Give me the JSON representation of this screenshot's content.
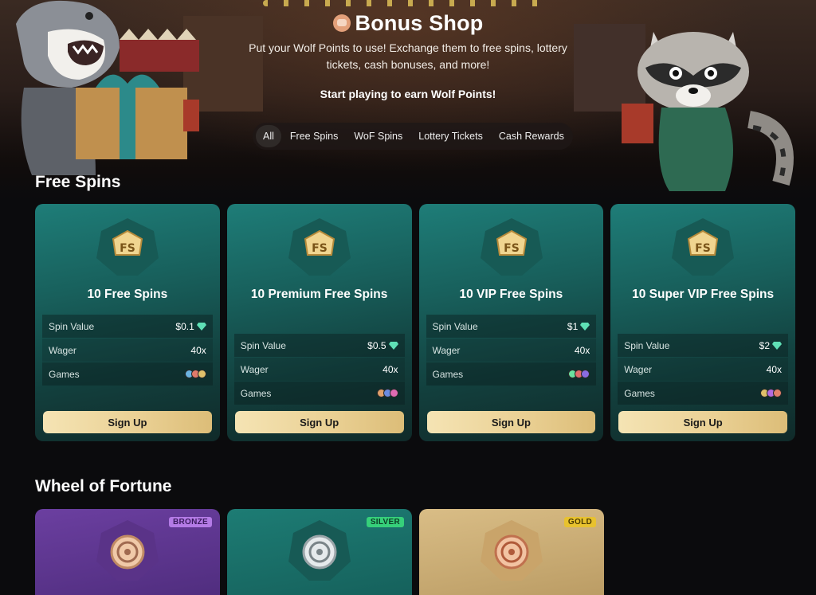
{
  "hero": {
    "title": "Bonus Shop",
    "description": "Put your Wolf Points to use! Exchange them to free spins, lottery tickets, cash bonuses, and more!",
    "cta": "Start playing to earn Wolf Points!"
  },
  "tabs": [
    {
      "label": "All",
      "active": true
    },
    {
      "label": "Free Spins"
    },
    {
      "label": "WoF Spins"
    },
    {
      "label": "Lottery Tickets"
    },
    {
      "label": "Cash Rewards"
    }
  ],
  "free_spins": {
    "section_title": "Free Spins",
    "badge_text": "FS",
    "row_labels": {
      "spin_value": "Spin Value",
      "wager": "Wager",
      "games": "Games"
    },
    "button_label": "Sign Up",
    "cards": [
      {
        "title": "10 Free Spins",
        "spin_value": "$0.1",
        "wager": "40x"
      },
      {
        "title": "10 Premium Free Spins",
        "spin_value": "$0.5",
        "wager": "40x"
      },
      {
        "title": "10 VIP Free Spins",
        "spin_value": "$1",
        "wager": "40x"
      },
      {
        "title": "10 Super VIP Free Spins",
        "spin_value": "$2",
        "wager": "40x"
      }
    ]
  },
  "wheel_of_fortune": {
    "section_title": "Wheel of Fortune",
    "cards": [
      {
        "tier": "BRONZE"
      },
      {
        "tier": "SILVER"
      },
      {
        "tier": "GOLD"
      }
    ]
  },
  "colors": {
    "background": "#0b0b0d",
    "card_teal": "#18605c",
    "button_gold": "#e9cf92",
    "gem": "#5fe0b6",
    "bronze_card": "#6b3fa0",
    "silver_card": "#1d7c74",
    "gold_card": "#d9bd86"
  }
}
